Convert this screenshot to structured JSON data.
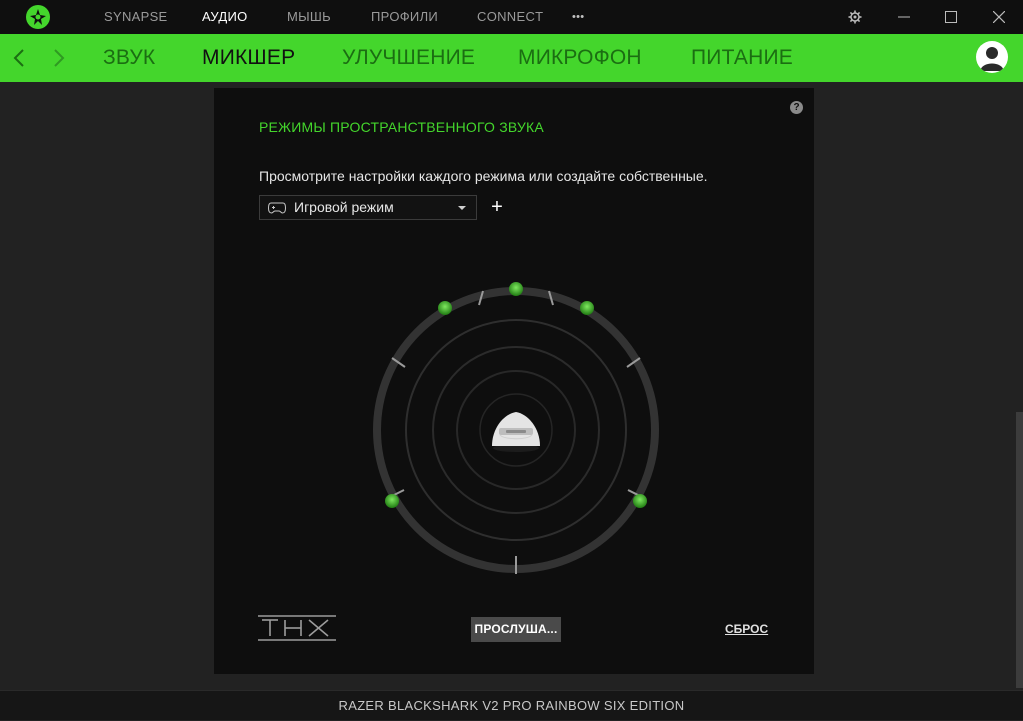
{
  "app": {
    "topnav": [
      "SYNAPSE",
      "АУДИО",
      "МЫШЬ",
      "ПРОФИЛИ",
      "CONNECT"
    ],
    "more_icon": "•••",
    "active_topnav": "АУДИО"
  },
  "subnav": {
    "items": [
      "ЗВУК",
      "МИКШЕР",
      "УЛУЧШЕНИЕ",
      "МИКРОФОН",
      "ПИТАНИЕ"
    ],
    "active": "МИКШЕР"
  },
  "panel": {
    "title": "РЕЖИМЫ ПРОСТРАНСТВЕННОГО ЗВУКА",
    "description": "Просмотрите настройки каждого режима или создайте собственные.",
    "help": "?",
    "mode_select": {
      "value": "Игровой режим",
      "icon": "gamepad-icon"
    },
    "add_label": "+",
    "thx_logo": "THX",
    "listen_button": "ПРОСЛУША...",
    "reset_link": "СБРОС"
  },
  "device_name": "RAZER BLACKSHARK V2 PRO RAINBOW SIX EDITION",
  "colors": {
    "accent": "#44d62c",
    "background": "#222222",
    "panel": "#0e0e0e"
  }
}
